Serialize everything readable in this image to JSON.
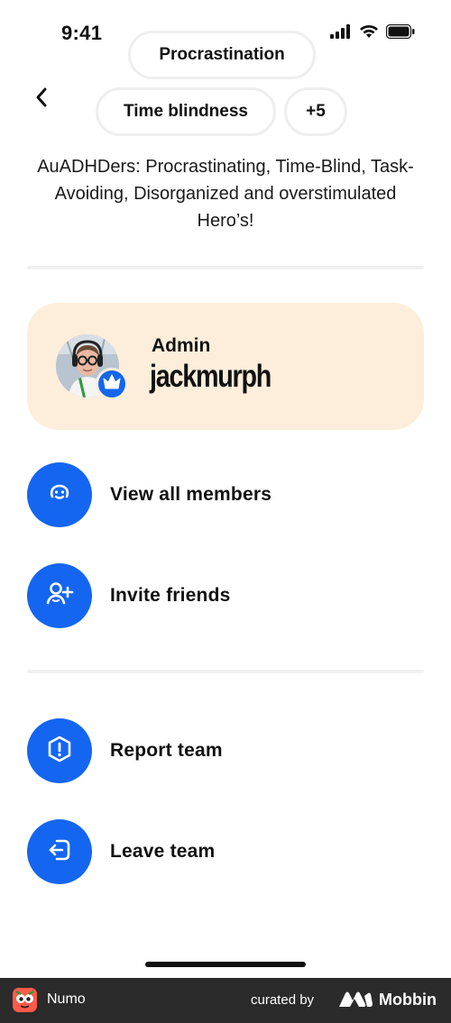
{
  "status_bar": {
    "time": "9:41"
  },
  "header": {
    "back_icon": "chevron-left-icon",
    "tags": [
      "Procrastination",
      "Time blindness",
      "+5"
    ]
  },
  "team": {
    "description": "AuADHDers: Procrastinating, Time-Blind, Task-Avoiding, Disorganized and overstimulated Hero’s!"
  },
  "admin": {
    "role": "Admin",
    "username": "jackmurph",
    "badge_icon": "crown-icon"
  },
  "actions": [
    {
      "label": "View all members",
      "icon": "smiley-face-icon"
    },
    {
      "label": "Invite friends",
      "icon": "add-person-icon"
    },
    {
      "label": "Report team",
      "icon": "report-shield-icon"
    },
    {
      "label": "Leave team",
      "icon": "exit-icon"
    }
  ],
  "footer": {
    "app_name": "Numo",
    "curated_by": "curated by",
    "brand": "Mobbin"
  },
  "colors": {
    "accent": "#1466f0",
    "admin_card": "#fdeedb",
    "divider": "#f0f0f0",
    "footer_bg": "#2b2b2b"
  }
}
